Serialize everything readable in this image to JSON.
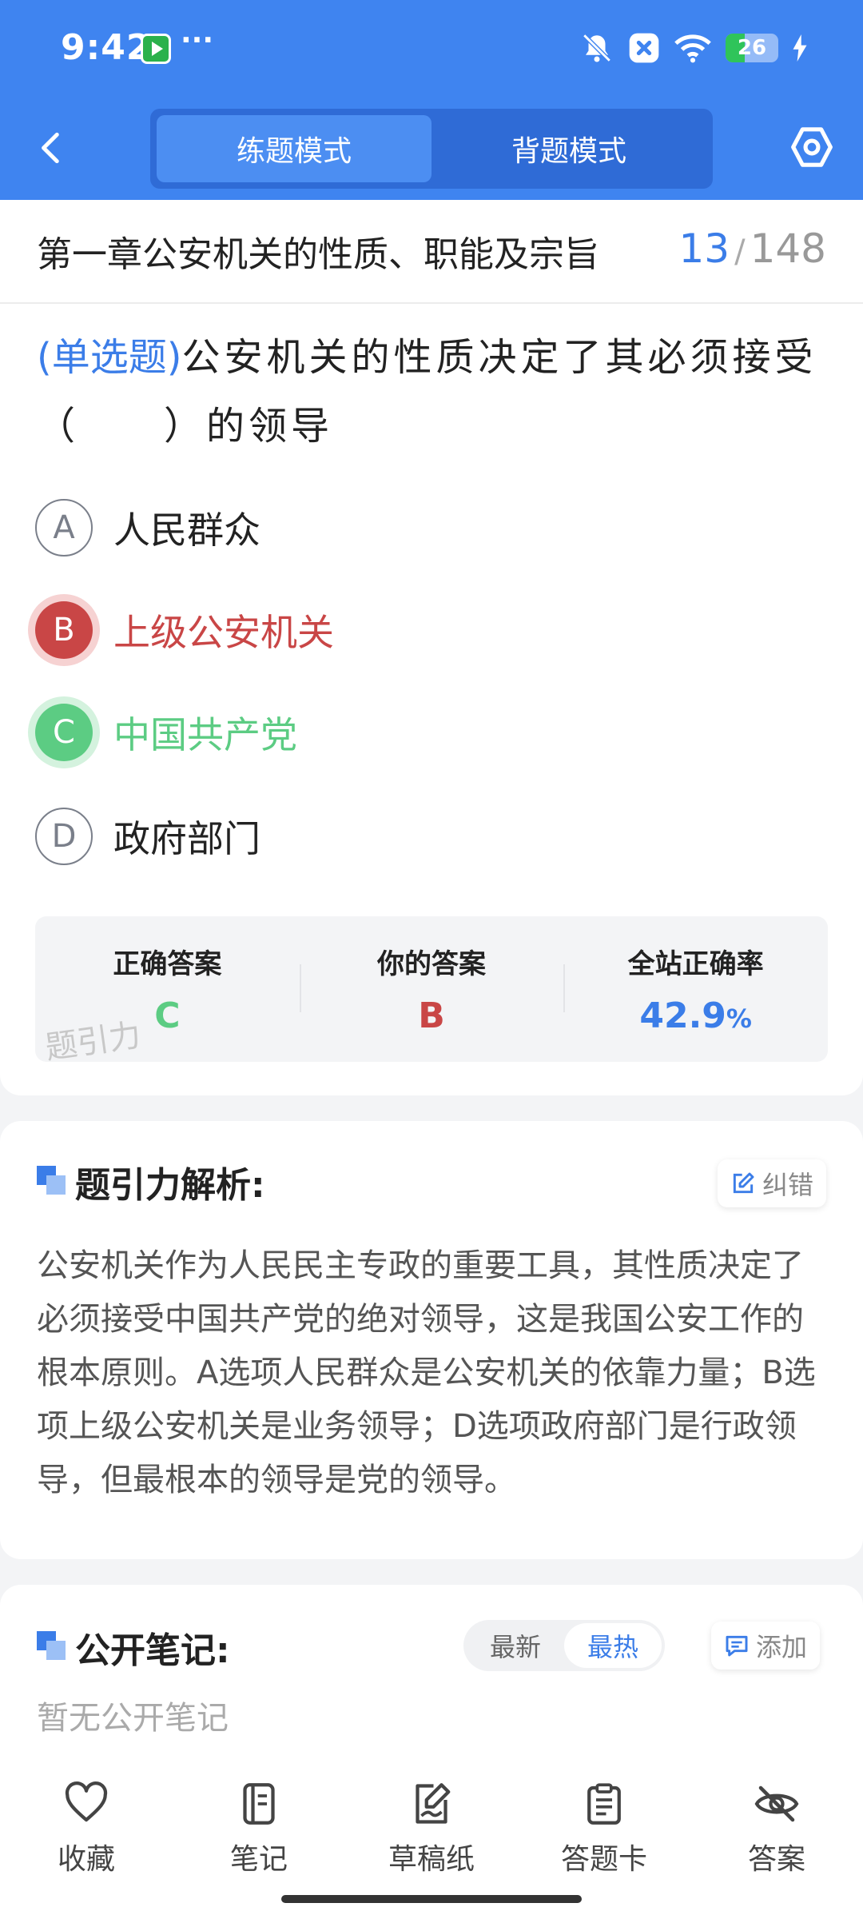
{
  "status_bar": {
    "time": "9:42",
    "more": "···",
    "battery_level": "26",
    "battery_fraction": 0.26,
    "icons": [
      "app-store-icon",
      "mute-bell-icon",
      "x-app-icon",
      "wifi-icon",
      "battery-icon",
      "charging-icon"
    ]
  },
  "header": {
    "modes": [
      "练题模式",
      "背题模式"
    ],
    "active_mode": "练题模式"
  },
  "question": {
    "chapter": "第一章公安机关的性质、职能及宗旨",
    "current": "13",
    "separator": "/",
    "total": "148",
    "type": "(单选题)",
    "text": "公安机关的性质决定了其必须接受（　　）的领导",
    "options": [
      {
        "letter": "A",
        "text": "人民群众",
        "state": "normal"
      },
      {
        "letter": "B",
        "text": "上级公安机关",
        "state": "wrong"
      },
      {
        "letter": "C",
        "text": "中国共产党",
        "state": "correct"
      },
      {
        "letter": "D",
        "text": "政府部门",
        "state": "normal"
      }
    ]
  },
  "answer_summary": {
    "correct_label": "正确答案",
    "correct_value": "C",
    "mine_label": "你的答案",
    "mine_value": "B",
    "rate_label": "全站正确率",
    "rate_value": "42.9",
    "rate_unit": "%",
    "watermark": "题引力"
  },
  "analysis": {
    "title": "题引力解析:",
    "report_label": "纠错",
    "body": "公安机关作为人民民主专政的重要工具，其性质决定了必须接受中国共产党的绝对领导，这是我国公安工作的根本原则。A选项人民群众是公安机关的依靠力量；B选项上级公安机关是业务领导；D选项政府部门是行政领导，但最根本的领导是党的领导。"
  },
  "notes": {
    "title": "公开笔记:",
    "sort_options": [
      "最新",
      "最热"
    ],
    "active_sort": "最热",
    "add_label": "添加",
    "empty_text": "暂无公开笔记"
  },
  "bottom_nav": [
    {
      "label": "收藏",
      "icon": "heart-icon"
    },
    {
      "label": "笔记",
      "icon": "notebook-icon"
    },
    {
      "label": "草稿纸",
      "icon": "draft-icon"
    },
    {
      "label": "答题卡",
      "icon": "answer-sheet-icon"
    },
    {
      "label": "答案",
      "icon": "eye-off-icon"
    }
  ],
  "colors": {
    "primary": "#3f84f0",
    "accent_blue": "#3b7de8",
    "wrong": "#c94646",
    "correct": "#5ccc83"
  }
}
